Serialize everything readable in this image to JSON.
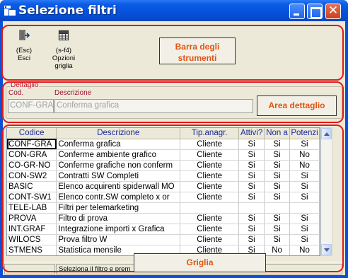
{
  "window": {
    "title": "Selezione filtri"
  },
  "toolbar": {
    "buttons": [
      {
        "key": "(Esc)",
        "label": "Esci",
        "icon": "exit-door-icon"
      },
      {
        "key": "(s-f4)",
        "label": "Opzioni griglia",
        "icon": "grid-options-icon"
      }
    ]
  },
  "detail": {
    "group_label": "Dettaglio",
    "cod_label": "Cod.",
    "desc_label": "Descrizione",
    "cod_value": "CONF-GRA",
    "desc_value": "Conferma grafica"
  },
  "grid": {
    "columns": [
      "Codice",
      "Descrizione",
      "Tip.anagr.",
      "Attivi?",
      "Non a",
      "Potenzi"
    ],
    "rows": [
      [
        "CONF-GRA",
        "Conferma grafica",
        "Cliente",
        "Si",
        "Si",
        "Si"
      ],
      [
        "CON-GRA",
        "Conferme ambiente grafico",
        "Cliente",
        "Si",
        "Si",
        "No"
      ],
      [
        "CO-GR-NO",
        "Conferme grafiche non conferm",
        "Cliente",
        "Si",
        "Si",
        "No"
      ],
      [
        "CON-SW2",
        "Contratti SW Completi",
        "Cliente",
        "Si",
        "Si",
        "Si"
      ],
      [
        "BASIC",
        "Elenco acquirenti spiderwall MO",
        "Cliente",
        "Si",
        "Si",
        "Si"
      ],
      [
        "CONT-SW1",
        "Elenco contr.SW completo x or",
        "Cliente",
        "Si",
        "Si",
        "Si"
      ],
      [
        "TELE-LAB",
        "Filtri per telemarketing",
        "",
        "",
        "",
        ""
      ],
      [
        "PROVA",
        "Filtro di prova",
        "Cliente",
        "Si",
        "Si",
        "Si"
      ],
      [
        "INT.GRAF",
        "Integrazione importi x Grafica",
        "Cliente",
        "Si",
        "Si",
        "Si"
      ],
      [
        "WILOCS",
        "Prova filtro W",
        "Cliente",
        "Si",
        "Si",
        "Si"
      ],
      [
        "STMENS",
        "Statistica mensile",
        "Cliente",
        "Si",
        "No",
        "No"
      ]
    ]
  },
  "statusbar": {
    "text": "Seleziona il filtro e prem"
  },
  "annotations": {
    "toolbar": "Barra degli strumenti",
    "detail": "Area dettaglio",
    "grid": "Griglia"
  },
  "colors": {
    "annotation_border": "#e01a1a",
    "annotation_text": "#e05414",
    "titlebar": "#0551da"
  }
}
